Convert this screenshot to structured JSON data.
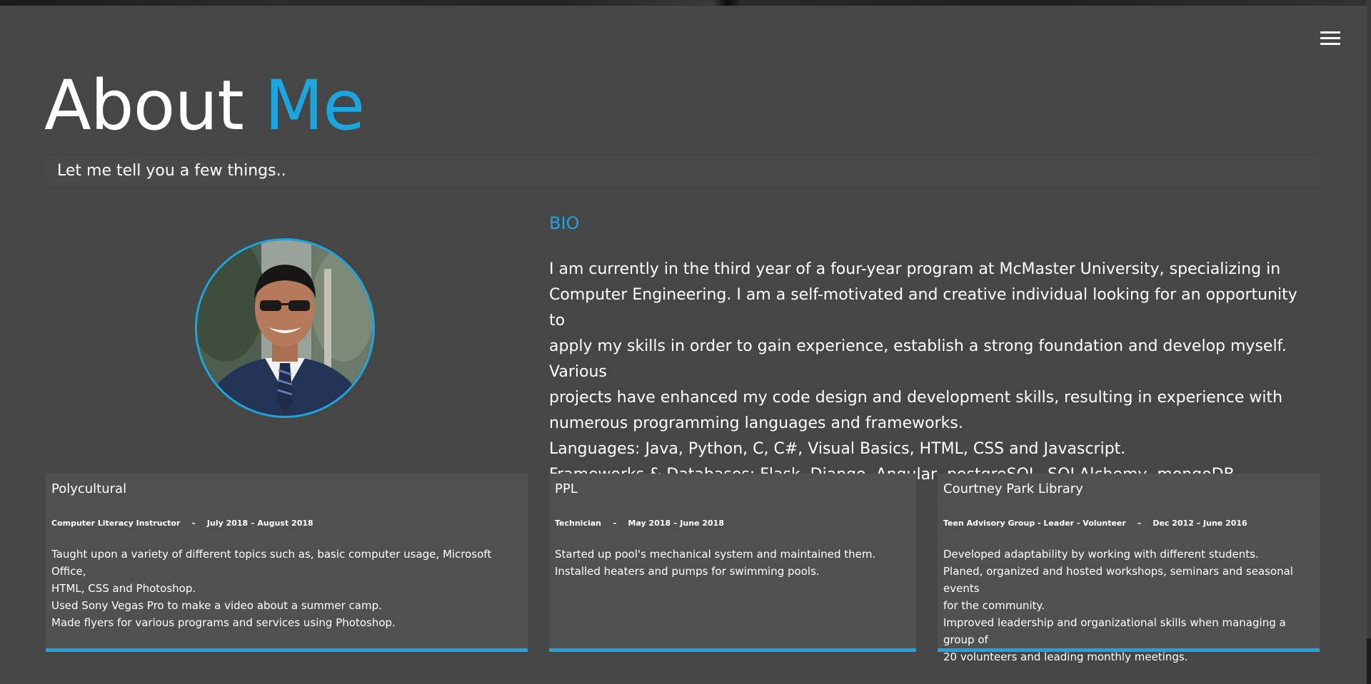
{
  "header": {
    "title_main": "About",
    "title_accent": "Me",
    "subtitle": "Let me tell you a few things..",
    "menu_icon": "hamburger-menu-icon",
    "accent_color": "#1aa6e0"
  },
  "bio": {
    "heading": "BIO",
    "lines": [
      "I am currently in the third year of a four-year program at McMaster University, specializing in",
      "Computer Engineering. I am a self-motivated and creative individual looking for an opportunity to",
      "apply my skills in order to gain experience, establish a strong foundation and develop myself. Various",
      "projects have enhanced my code design and development skills, resulting in experience with",
      "numerous programming languages and frameworks.",
      "Languages: Java, Python, C, C#, Visual Basics, HTML, CSS and Javascript.",
      "Frameworks & Databases: Flask, Django, Angular, postgreSQL, SQLAlchemy, mongoDB."
    ]
  },
  "experience": [
    {
      "company": "Polycultural",
      "role": "Computer Literacy Instructor",
      "separator": "–",
      "dates": "July 2018 – August 2018",
      "lines": [
        "Taught upon a variety of different topics such as, basic computer usage, Microsoft Office,",
        "HTML, CSS and Photoshop.",
        "Used Sony Vegas Pro to make a video about a summer camp.",
        "Made flyers for various programs and services using Photoshop."
      ]
    },
    {
      "company": "PPL",
      "role": "Technician",
      "separator": "–",
      "dates": "May 2018 – June 2018",
      "lines": [
        "Started up pool's mechanical system and maintained them.",
        "Installed heaters and pumps for swimming pools."
      ]
    },
    {
      "company": "Courtney Park Library",
      "role": "Teen Advisory Group - Leader - Volunteer",
      "separator": "–",
      "dates": "Dec 2012 – June 2016",
      "lines": [
        "Developed adaptability by working with different students.",
        "Planed, organized and hosted workshops, seminars and seasonal events",
        "for the community.",
        "Improved leadership and organizational skills when managing a group of",
        "20 volunteers and leading monthly meetings."
      ]
    }
  ]
}
